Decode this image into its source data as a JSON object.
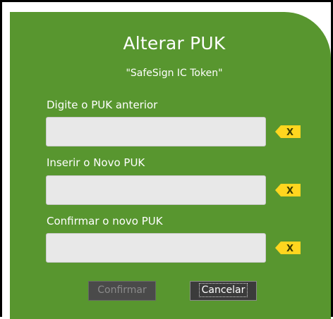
{
  "dialog": {
    "title": "Alterar PUK",
    "subtitle": "\"SafeSign IC Token\""
  },
  "fields": [
    {
      "label": "Digite o PUK anterior",
      "value": "",
      "clear_label": "X"
    },
    {
      "label": "Inserir o Novo PUK",
      "value": "",
      "clear_label": "X"
    },
    {
      "label": "Confirmar o novo PUK",
      "value": "",
      "clear_label": "X"
    }
  ],
  "buttons": {
    "confirm_label": "Confirmar",
    "cancel_label": "Cancelar",
    "confirm_enabled": false
  },
  "colors": {
    "dialog_background": "#58962f",
    "clear_button": "#ffd61f",
    "input_background": "#e8e8e8"
  },
  "icons": {
    "clear": "clear-x-icon"
  }
}
